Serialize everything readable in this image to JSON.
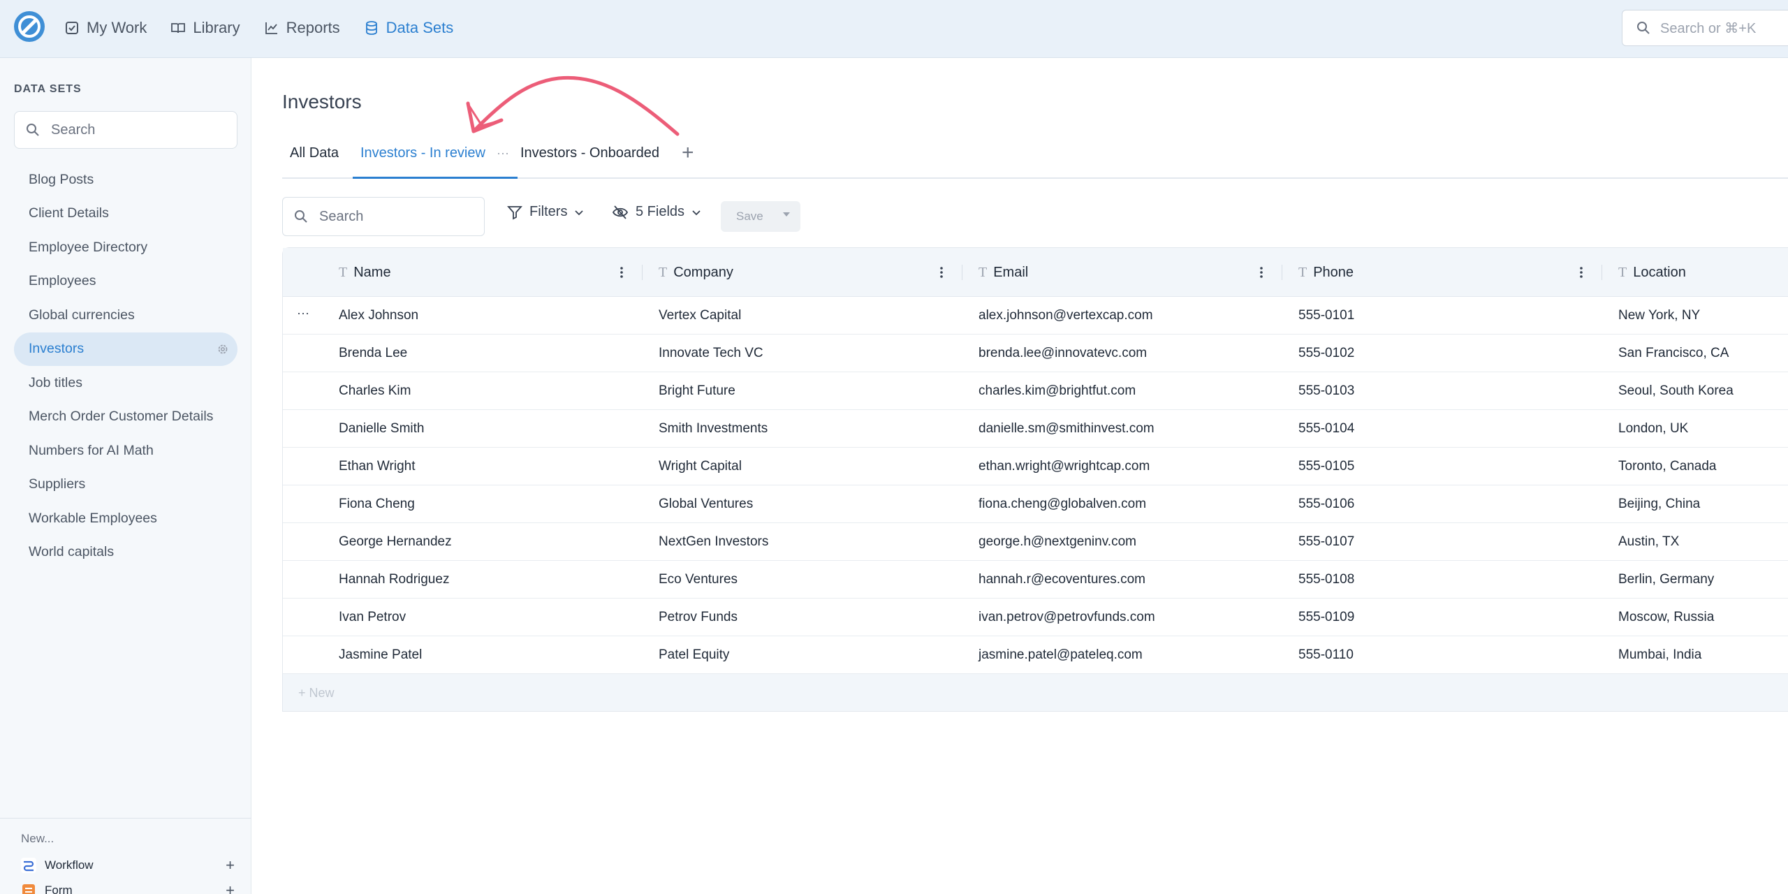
{
  "topbar": {
    "nav": [
      {
        "label": "My Work",
        "icon": "checkbox-icon"
      },
      {
        "label": "Library",
        "icon": "book-icon"
      },
      {
        "label": "Reports",
        "icon": "chart-line-icon"
      },
      {
        "label": "Data Sets",
        "icon": "database-icon",
        "active": true
      }
    ],
    "search_placeholder": "Search or ⌘+K"
  },
  "sidebar": {
    "heading": "DATA SETS",
    "search_placeholder": "Search",
    "items": [
      {
        "label": "Blog Posts"
      },
      {
        "label": "Client Details"
      },
      {
        "label": "Employee Directory"
      },
      {
        "label": "Employees"
      },
      {
        "label": "Global currencies"
      },
      {
        "label": "Investors",
        "active": true
      },
      {
        "label": "Job titles"
      },
      {
        "label": "Merch Order Customer Details"
      },
      {
        "label": "Numbers for AI Math"
      },
      {
        "label": "Suppliers"
      },
      {
        "label": "Workable Employees"
      },
      {
        "label": "World capitals"
      }
    ],
    "new_label": "New...",
    "new_items": [
      {
        "label": "Workflow"
      },
      {
        "label": "Form"
      }
    ]
  },
  "main": {
    "title": "Investors",
    "tabs": [
      {
        "label": "All Data"
      },
      {
        "label": "Investors - In review",
        "active": true,
        "menu": "···"
      },
      {
        "label": "Investors - Onboarded"
      }
    ],
    "add_tab": "+",
    "toolbar": {
      "search_placeholder": "Search",
      "filters_label": "Filters",
      "fields_label": "5 Fields",
      "save_label": "Save"
    },
    "table": {
      "columns": [
        {
          "label": "Name",
          "type_icon": "T"
        },
        {
          "label": "Company",
          "type_icon": "T"
        },
        {
          "label": "Email",
          "type_icon": "T"
        },
        {
          "label": "Phone",
          "type_icon": "T"
        },
        {
          "label": "Location",
          "type_icon": "T"
        }
      ],
      "row_menu": "···",
      "rows": [
        {
          "name": "Alex Johnson",
          "company": "Vertex Capital",
          "email": "alex.johnson@vertexcap.com",
          "phone": "555-0101",
          "location": "New York, NY"
        },
        {
          "name": "Brenda Lee",
          "company": "Innovate Tech VC",
          "email": "brenda.lee@innovatevc.com",
          "phone": "555-0102",
          "location": "San Francisco, CA"
        },
        {
          "name": "Charles Kim",
          "company": "Bright Future",
          "email": "charles.kim@brightfut.com",
          "phone": "555-0103",
          "location": "Seoul, South Korea"
        },
        {
          "name": "Danielle Smith",
          "company": "Smith Investments",
          "email": "danielle.sm@smithinvest.com",
          "phone": "555-0104",
          "location": "London, UK"
        },
        {
          "name": "Ethan Wright",
          "company": "Wright Capital",
          "email": "ethan.wright@wrightcap.com",
          "phone": "555-0105",
          "location": "Toronto, Canada"
        },
        {
          "name": "Fiona Cheng",
          "company": "Global Ventures",
          "email": "fiona.cheng@globalven.com",
          "phone": "555-0106",
          "location": "Beijing, China"
        },
        {
          "name": "George Hernandez",
          "company": "NextGen Investors",
          "email": "george.h@nextgeninv.com",
          "phone": "555-0107",
          "location": "Austin, TX"
        },
        {
          "name": "Hannah Rodriguez",
          "company": "Eco Ventures",
          "email": "hannah.r@ecoventures.com",
          "phone": "555-0108",
          "location": "Berlin, Germany"
        },
        {
          "name": "Ivan Petrov",
          "company": "Petrov Funds",
          "email": "ivan.petrov@petrovfunds.com",
          "phone": "555-0109",
          "location": "Moscow, Russia"
        },
        {
          "name": "Jasmine Patel",
          "company": "Patel Equity",
          "email": "jasmine.patel@pateleq.com",
          "phone": "555-0110",
          "location": "Mumbai, India"
        }
      ],
      "new_row_label": "+ New"
    }
  },
  "colors": {
    "accent": "#2b7fd0",
    "topbar_bg": "#e9f1f9",
    "sidebar_bg": "#f5f8fb",
    "annotation_arrow": "#ec5d78"
  }
}
